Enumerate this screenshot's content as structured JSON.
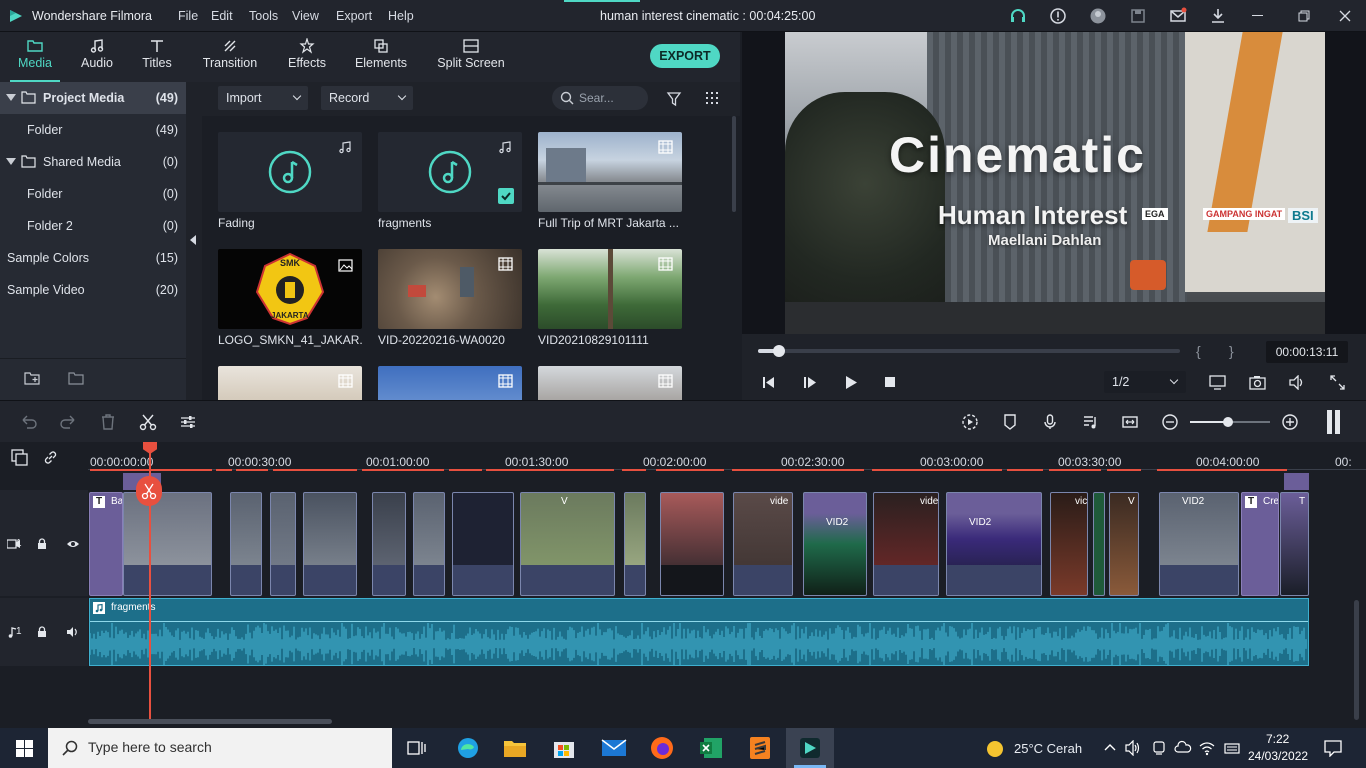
{
  "titlebar": {
    "app_name": "Wondershare Filmora",
    "menu": [
      "File",
      "Edit",
      "Tools",
      "View",
      "Export",
      "Help"
    ],
    "project_title": "human interest cinematic : 00:04:25:00"
  },
  "tabs": [
    {
      "label": "Media",
      "icon": "folder-icon",
      "active": true
    },
    {
      "label": "Audio",
      "icon": "music-note-icon"
    },
    {
      "label": "Titles",
      "icon": "text-T-icon"
    },
    {
      "label": "Transition",
      "icon": "transition-icon"
    },
    {
      "label": "Effects",
      "icon": "effects-icon"
    },
    {
      "label": "Elements",
      "icon": "elements-icon"
    },
    {
      "label": "Split Screen",
      "icon": "split-screen-icon"
    }
  ],
  "export_label": "EXPORT",
  "sidebar": {
    "items": [
      {
        "label": "Project Media",
        "count": "(49)"
      },
      {
        "label": "Folder",
        "count": "(49)"
      },
      {
        "label": "Shared Media",
        "count": "(0)"
      },
      {
        "label": "Folder",
        "count": "(0)"
      },
      {
        "label": "Folder 2",
        "count": "(0)"
      },
      {
        "label": "Sample Colors",
        "count": "(15)"
      },
      {
        "label": "Sample Video",
        "count": "(20)"
      }
    ]
  },
  "mediabar": {
    "import_label": "Import",
    "record_label": "Record",
    "search_placeholder": "Sear..."
  },
  "media": [
    {
      "caption": "Fading",
      "kind": "audio"
    },
    {
      "caption": "fragments",
      "kind": "audio",
      "checked": true
    },
    {
      "caption": "Full Trip of MRT Jakarta ...",
      "kind": "video"
    },
    {
      "caption": "LOGO_SMKN_41_JAKAR...",
      "kind": "image"
    },
    {
      "caption": "VID-20220216-WA0020",
      "kind": "video"
    },
    {
      "caption": "VID20210829101111",
      "kind": "video"
    }
  ],
  "logo_text": {
    "top": "SMK",
    "bottom": "JAKARTA"
  },
  "preview": {
    "title_big": "Cinematic",
    "title_mid": "Human Interest",
    "title_small": "Maellani Dahlan",
    "timecode": "00:00:13:11",
    "brackets": [
      "{",
      "}"
    ],
    "quality": "1/2",
    "progress": 0.05,
    "signs": [
      "EGA",
      "GAMPANG INGAT",
      "BSI"
    ]
  },
  "ruler": [
    "00:00:00:00",
    "00:00:30:00",
    "00:01:00:00",
    "00:01:30:00",
    "00:02:00:00",
    "00:02:30:00",
    "00:03:00:00",
    "00:03:30:00",
    "00:04:00:00",
    "00:"
  ],
  "tracks": {
    "video_label": "1",
    "audio_label": "1",
    "audio_clip_name": "fragments"
  },
  "clip_labels": [
    "Ba",
    "V",
    "vide",
    "VID2",
    "vide",
    "VID2",
    "vic",
    "V",
    "VID2",
    "Cre",
    "T"
  ],
  "taskbar": {
    "search_placeholder": "Type here to search",
    "weather": "25°C  Cerah",
    "time": "7:22",
    "date": "24/03/2022"
  }
}
